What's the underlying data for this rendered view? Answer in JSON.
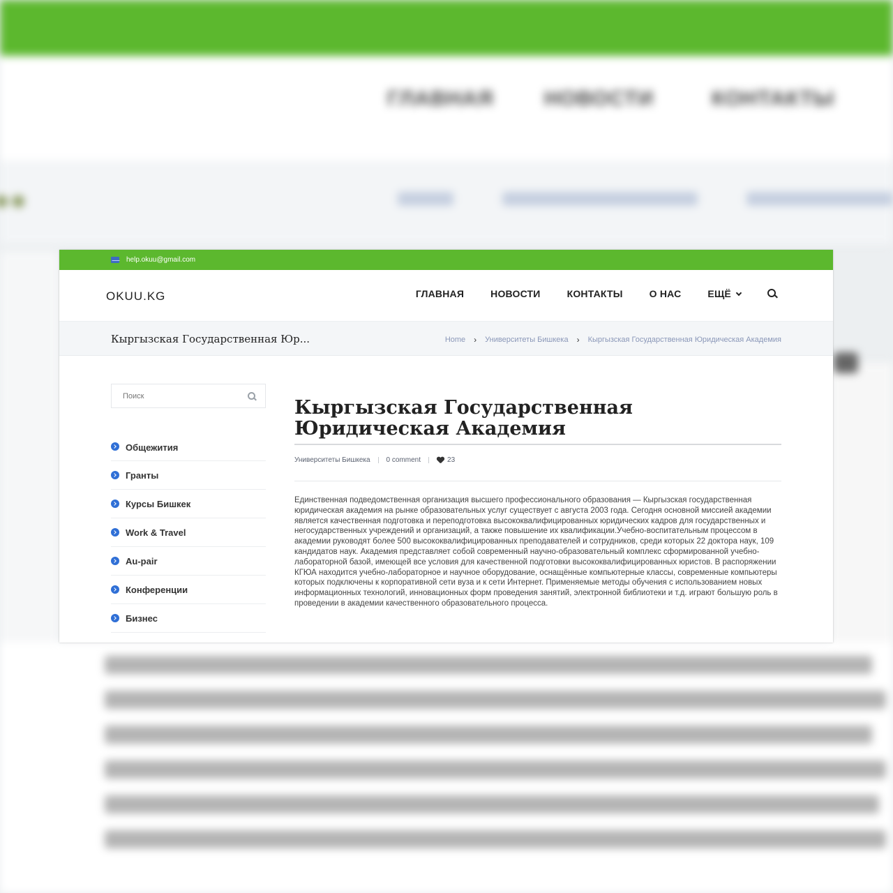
{
  "background": {
    "nav": [
      "ГЛАВНАЯ",
      "НОВОСТИ",
      "КОНТАКТЫ"
    ]
  },
  "topbar": {
    "email": "help.okuu@gmail.com"
  },
  "header": {
    "logo": "OKUU.KG",
    "nav": [
      "ГЛАВНАЯ",
      "НОВОСТИ",
      "КОНТАКТЫ",
      "О НАС",
      "ЕЩЁ"
    ]
  },
  "pagebar": {
    "title": "Кыргызская Государственная Юр...",
    "breadcrumb": [
      "Home",
      "Университеты Бишкека",
      "Кыргызская Государственная Юридическая Академия"
    ]
  },
  "sidebar": {
    "search_placeholder": "Поиск",
    "categories": [
      "Общежития",
      "Гранты",
      "Курсы Бишкек",
      "Work & Travel",
      "Au-pair",
      "Конференции",
      "Бизнес"
    ]
  },
  "article": {
    "title": "Кыргызская Государственная Юридическая Академия",
    "category": "Университеты Бишкека",
    "comments": "0 comment",
    "likes": "23",
    "body": "Единственная подведомственная организация высшего профессионального образования — Кыргызская государственная юридическая академия на рынке образовательных услуг существует с августа 2003 года. Сегодня основной миссией академии является качественная подготовка и переподготовка высококвалифицированных юридических кадров для государственных и негосударственных учреждений и организаций, а также повышение их квалификации.Учебно-воспитательным процессом в академии руководят более 500 высококвалифицированных преподавателей и сотрудников, среди которых 22 доктора наук, 109 кандидатов наук. Академия представляет собой современный научно-образовательный комплекс сформированной учебно-лабораторной базой, имеющей все условия для качественной подготовки высококвалифицированных юристов. В распоряжении КГЮА находится учебно-лабораторное и научное оборудование, оснащённые компьютерные классы, современные компьютеры которых подключены к корпоративной сети вуза и к сети Интернет. Применяемые методы обучения с использованием новых информационных технологий, инновационных форм проведения занятий, электронной библиотеки и т.д. играют большую роль в проведении в академии качественного образовательного процесса."
  },
  "colors": {
    "brand_green": "#5cb82e",
    "link_blue": "#2f6fd6"
  }
}
